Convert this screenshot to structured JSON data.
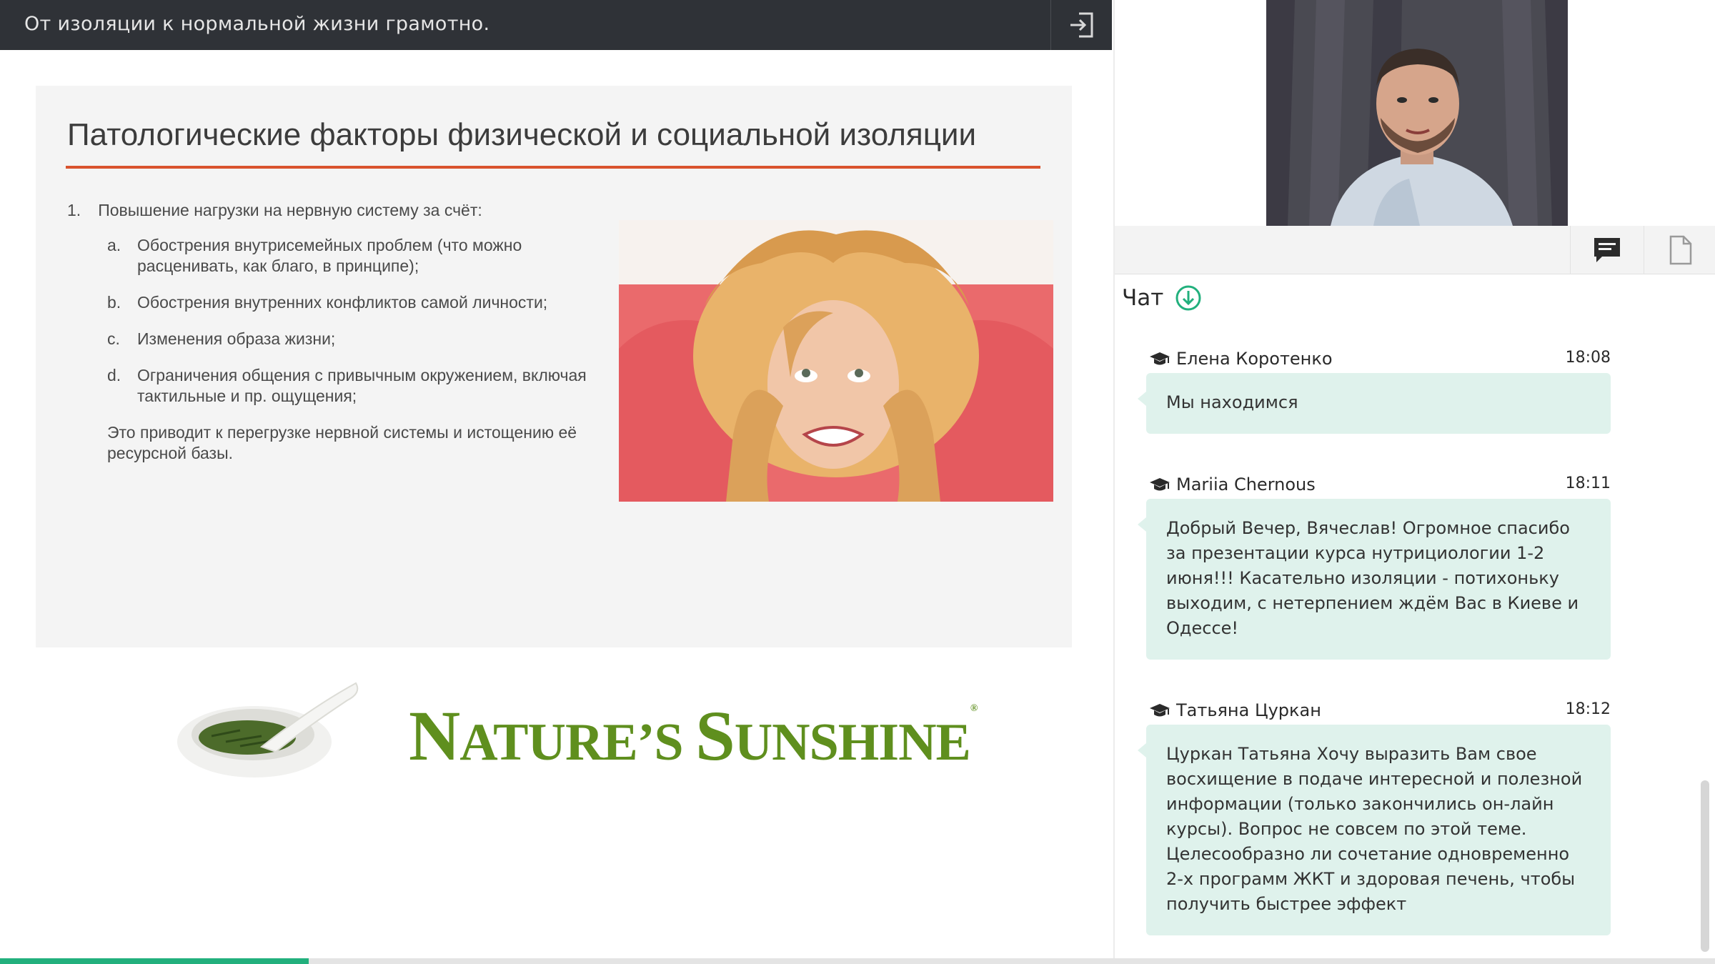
{
  "topbar": {
    "title": "От изоляции к нормальной жизни грамотно.",
    "exit_icon": "exit-icon"
  },
  "slide": {
    "heading": "Патологические факторы физической и социальной изоляции",
    "item1_number": "1.",
    "item1_text": "Повышение нагрузки на нервную систему за счёт:",
    "subitems": [
      {
        "letter": "a.",
        "text": "Обострения внутрисемейных проблем (что можно расценивать, как благо, в принципе);"
      },
      {
        "letter": "b.",
        "text": "Обострения внутренних конфликтов самой личности;"
      },
      {
        "letter": "c.",
        "text": "Изменения образа жизни;"
      },
      {
        "letter": "d.",
        "text": "Ограничения общения с привычным окружением, включая тактильные и пр. ощущения;"
      }
    ],
    "conclusion": "Это приводит к перегрузке нервной системы и истощению её ресурсной базы."
  },
  "logo": {
    "brand_n": "N",
    "brand_ature": "ATURE",
    "brand_apos_s": "’S ",
    "brand_s": "S",
    "brand_unshine": "UNSHINE",
    "registered": "®"
  },
  "progress": {
    "value": 0.18,
    "color": "#22b07d"
  },
  "toolbar": {
    "chat_icon": "chat-bubble-icon",
    "file_icon": "document-icon"
  },
  "chat": {
    "label": "Чат",
    "messages": [
      {
        "author": "Елена Коротенко",
        "time": "18:08",
        "text": "Мы находимся"
      },
      {
        "author": "Mariia Chernous",
        "time": "18:11",
        "text": "Добрый Вечер, Вячеслав! Огромное спасибо за презентации курса нутрициологии 1-2 июня!!! Касательно изоляции - потихоньку выходим, с нетерпением ждём Вас в Киеве и Одессе!"
      },
      {
        "author": "Татьяна Цуркан",
        "time": "18:12",
        "text": "Цуркан Татьяна Хочу выразить Вам свое восхищение в подаче интересной и полезной информации (только закончились он-лайн курсы). Вопрос не совсем по этой теме. Целесообразно ли сочетание одновременно 2-х программ ЖКТ и здоровая печень, чтобы получить быстрее эффект"
      }
    ]
  },
  "colors": {
    "accent": "#22b07d",
    "topbar": "#2f3237",
    "bubble": "#dff2ec",
    "rule": "#d9532e",
    "brand": "#5f8f1e"
  }
}
